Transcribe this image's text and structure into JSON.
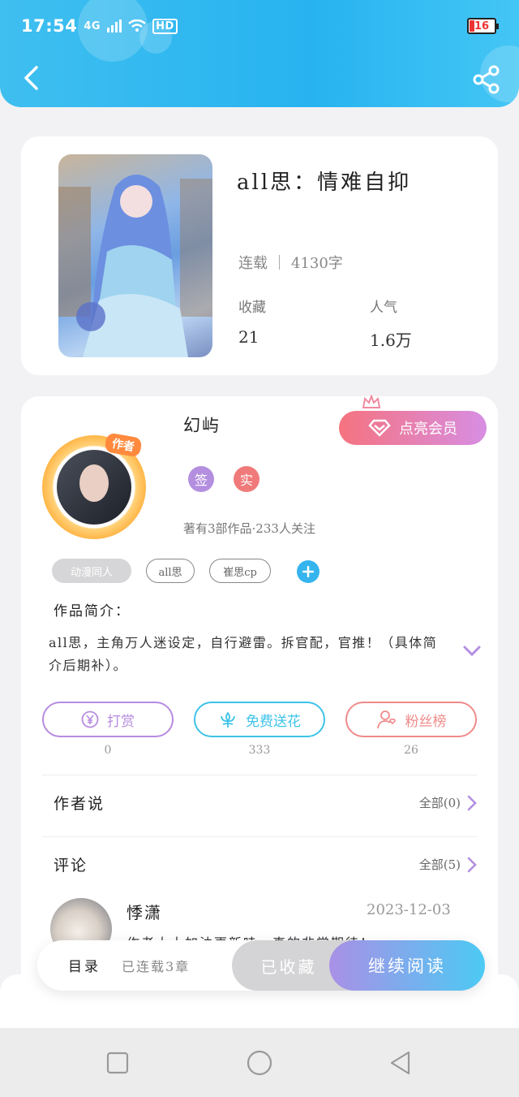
{
  "status_bar": {
    "time": "17:54",
    "network": "4G",
    "hd": "HD",
    "battery": "16"
  },
  "header": {
    "back_icon": "chevron-left-icon",
    "share_icon": "share-icon"
  },
  "book": {
    "title": "all思：情难自抑",
    "status": "连载",
    "word_count": "4130字",
    "favorites_label": "收藏",
    "favorites_value": "21",
    "popularity_label": "人气",
    "popularity_value": "1.6万"
  },
  "author": {
    "name": "幻屿",
    "avatar_tag": "作者",
    "vip_button": "点亮会员",
    "badges": [
      "签",
      "实"
    ],
    "works_info": "著有3部作品·233人关注",
    "tags": [
      "动漫同人",
      "all思",
      "崔思cp"
    ],
    "intro_label": "作品简介：",
    "intro_text": "all思，主角万人迷设定，自行避雷。拆官配，官推！（具体简介后期补）。"
  },
  "actions": [
    {
      "label": "打赏",
      "count": "0",
      "icon": "yen-icon",
      "color": "#b68be0"
    },
    {
      "label": "免费送花",
      "count": "333",
      "icon": "flower-icon",
      "color": "#3ec3e8"
    },
    {
      "label": "粉丝榜",
      "count": "26",
      "icon": "fan-ranking-icon",
      "color": "#f08a8a"
    }
  ],
  "author_says": {
    "title": "作者说",
    "all": "全部(0)"
  },
  "comments": {
    "title": "评论",
    "all": "全部(5)",
    "first": {
      "name": "悸潇",
      "date": "2023-12-03",
      "text": "作者大大加油更新哇，真的非常期待！"
    }
  },
  "bottom_bar": {
    "toc": "目录",
    "toc_count": "已连载3章",
    "favorited": "已收藏",
    "continue": "继续阅读"
  },
  "colors": {
    "accent": "#27b3f0",
    "vip_start": "#f5737f",
    "vip_end": "#d78ee3",
    "read_start": "#a990e6",
    "read_end": "#4ccaf4"
  }
}
